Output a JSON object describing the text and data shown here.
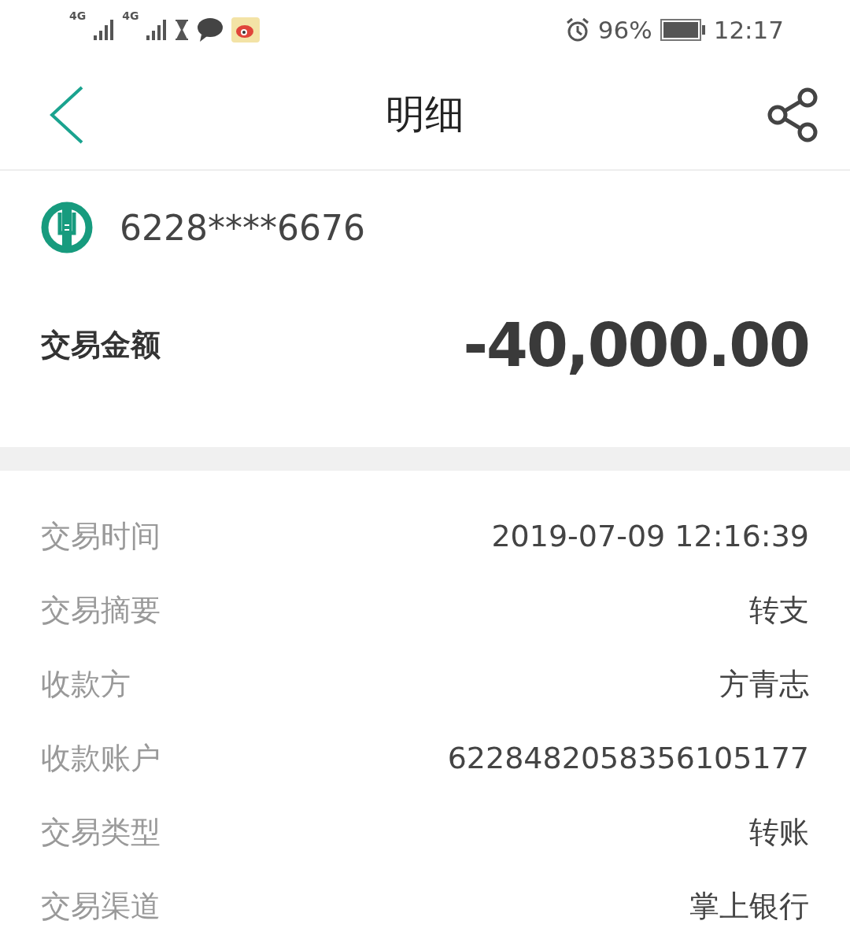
{
  "status_bar": {
    "networks": [
      "4G",
      "4G"
    ],
    "battery_percent": "96%",
    "time": "12:17"
  },
  "header": {
    "title": "明细"
  },
  "account": {
    "card_number": "6228****6676"
  },
  "amount": {
    "label": "交易金额",
    "value": "-40,000.00"
  },
  "details": [
    {
      "label": "交易时间",
      "value": "2019-07-09 12:16:39"
    },
    {
      "label": "交易摘要",
      "value": "转支"
    },
    {
      "label": "收款方",
      "value": "方青志"
    },
    {
      "label": "收款账户",
      "value": "6228482058356105177"
    },
    {
      "label": "交易类型",
      "value": "转账"
    },
    {
      "label": "交易渠道",
      "value": "掌上银行"
    }
  ]
}
